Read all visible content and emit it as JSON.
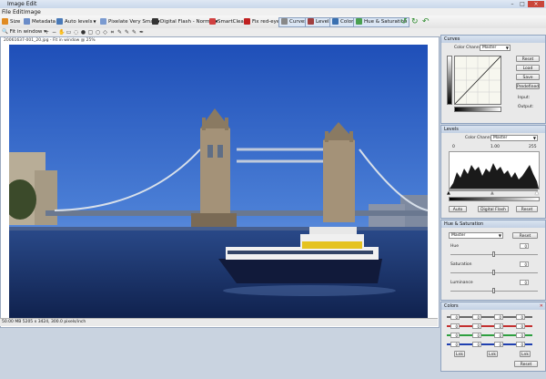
{
  "window": {
    "title": "Image Edit",
    "minimize": "–",
    "maximize": "□",
    "close": "×"
  },
  "menu": [
    "File",
    "Edit",
    "Image"
  ],
  "toolbar": {
    "size": "Size",
    "metadata": "Metadata",
    "auto_levels": "Auto levels",
    "pixelate": "Pixelate Very Small",
    "digital_flash": "Digital Flash - Normal",
    "smartclean": "SmartClean",
    "fix_redeye": "Fix red-eye",
    "curves": "Curves",
    "levels": "Levels",
    "colors": "Colors",
    "hue_saturation": "Hue & Saturation",
    "rotate_ccw_icon": "rotate-left-icon",
    "rotate_cw_icon": "rotate-right-icon",
    "undo_icon": "undo-icon"
  },
  "toolbar2": {
    "fit": "Fit in window"
  },
  "document": {
    "filename": "20061637-001_20.jpg - Fit in window @ 25%",
    "status": "50.00 MB  5205 x 3424, 300.0 pixels/inch"
  },
  "curves": {
    "title": "Curves",
    "channel_label": "Color Channel:",
    "channel": "Master",
    "reset": "Reset",
    "load": "Load",
    "save": "Save",
    "predefined": "Predefined",
    "input": "Input:",
    "output": "Output:"
  },
  "levels": {
    "title": "Levels",
    "channel_label": "Color Channel:",
    "channel": "Master",
    "in_low": "0",
    "gamma": "1.00",
    "in_high": "255",
    "auto": "Auto",
    "digital_flash": "Digital Flash",
    "reset": "Reset"
  },
  "hue_sat": {
    "title": "Hue & Saturation",
    "channel": "Master",
    "reset": "Reset",
    "hue_label": "Hue",
    "hue": "0",
    "sat_label": "Saturation",
    "sat": "0",
    "lum_label": "Luminance",
    "lum": "0"
  },
  "colors": {
    "title": "Colors",
    "reset": "Reset",
    "rows": [
      {
        "color": "#6a6a6a",
        "v1": "0",
        "v2": "0",
        "v3": "0",
        "v4": "0"
      },
      {
        "color": "#c43030",
        "v1": "0",
        "v2": "0",
        "v3": "0",
        "v4": "0"
      },
      {
        "color": "#2ea040",
        "v1": "0",
        "v2": "0",
        "v3": "0",
        "v4": "0"
      },
      {
        "color": "#2040b0",
        "v1": "0",
        "v2": "0",
        "v3": "0",
        "v4": "0"
      }
    ],
    "link1": "Lnk",
    "link2": "Lnk",
    "link3": "Lnk"
  }
}
